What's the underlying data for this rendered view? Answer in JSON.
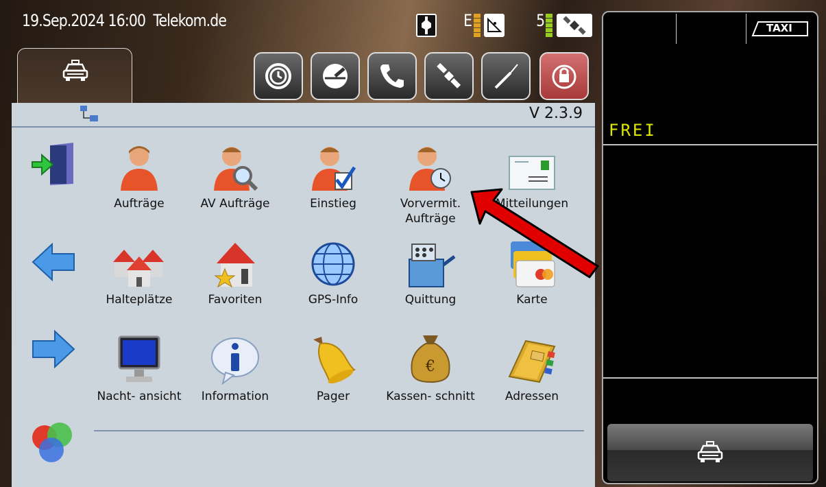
{
  "status_bar": {
    "datetime": "19.Sep.2024 16:00",
    "carrier": "Telekom.de",
    "network_letter": "E",
    "satellite_count": "5"
  },
  "tab": {
    "icon": "taxi-icon"
  },
  "toolbar": {
    "buttons": [
      "timer-icon",
      "speedometer-icon",
      "phone-icon",
      "satellite-icon",
      "tools-icon",
      "lock-icon"
    ]
  },
  "panel": {
    "version": "V 2.3.9",
    "grid": [
      {
        "label": "Aufträge",
        "icon": "person-icon"
      },
      {
        "label": "AV Aufträge",
        "icon": "person-search-icon"
      },
      {
        "label": "Einstieg",
        "icon": "person-check-icon"
      },
      {
        "label": "Vorvermit. Aufträge",
        "icon": "person-clock-icon"
      },
      {
        "label": "Mitteilungen",
        "icon": "message-icon"
      },
      {
        "label": "Halteplätze",
        "icon": "houses-icon"
      },
      {
        "label": "Favoriten",
        "icon": "favorite-house-icon"
      },
      {
        "label": "GPS-Info",
        "icon": "globe-icon"
      },
      {
        "label": "Quittung",
        "icon": "cash-register-icon"
      },
      {
        "label": "Karte",
        "icon": "card-icon"
      },
      {
        "label": "Nacht- ansicht",
        "icon": "night-monitor-icon"
      },
      {
        "label": "Information",
        "icon": "info-icon"
      },
      {
        "label": "Pager",
        "icon": "bell-icon"
      },
      {
        "label": "Kassen- schnitt",
        "icon": "money-bag-icon"
      },
      {
        "label": "Adressen",
        "icon": "address-book-icon"
      }
    ]
  },
  "right_panel": {
    "taxi_sign": "TAXI",
    "status": "FREI"
  },
  "colors": {
    "status_text": "#dde700",
    "annotation_arrow": "#e00000",
    "panel_bg": "#ccd4dc"
  }
}
